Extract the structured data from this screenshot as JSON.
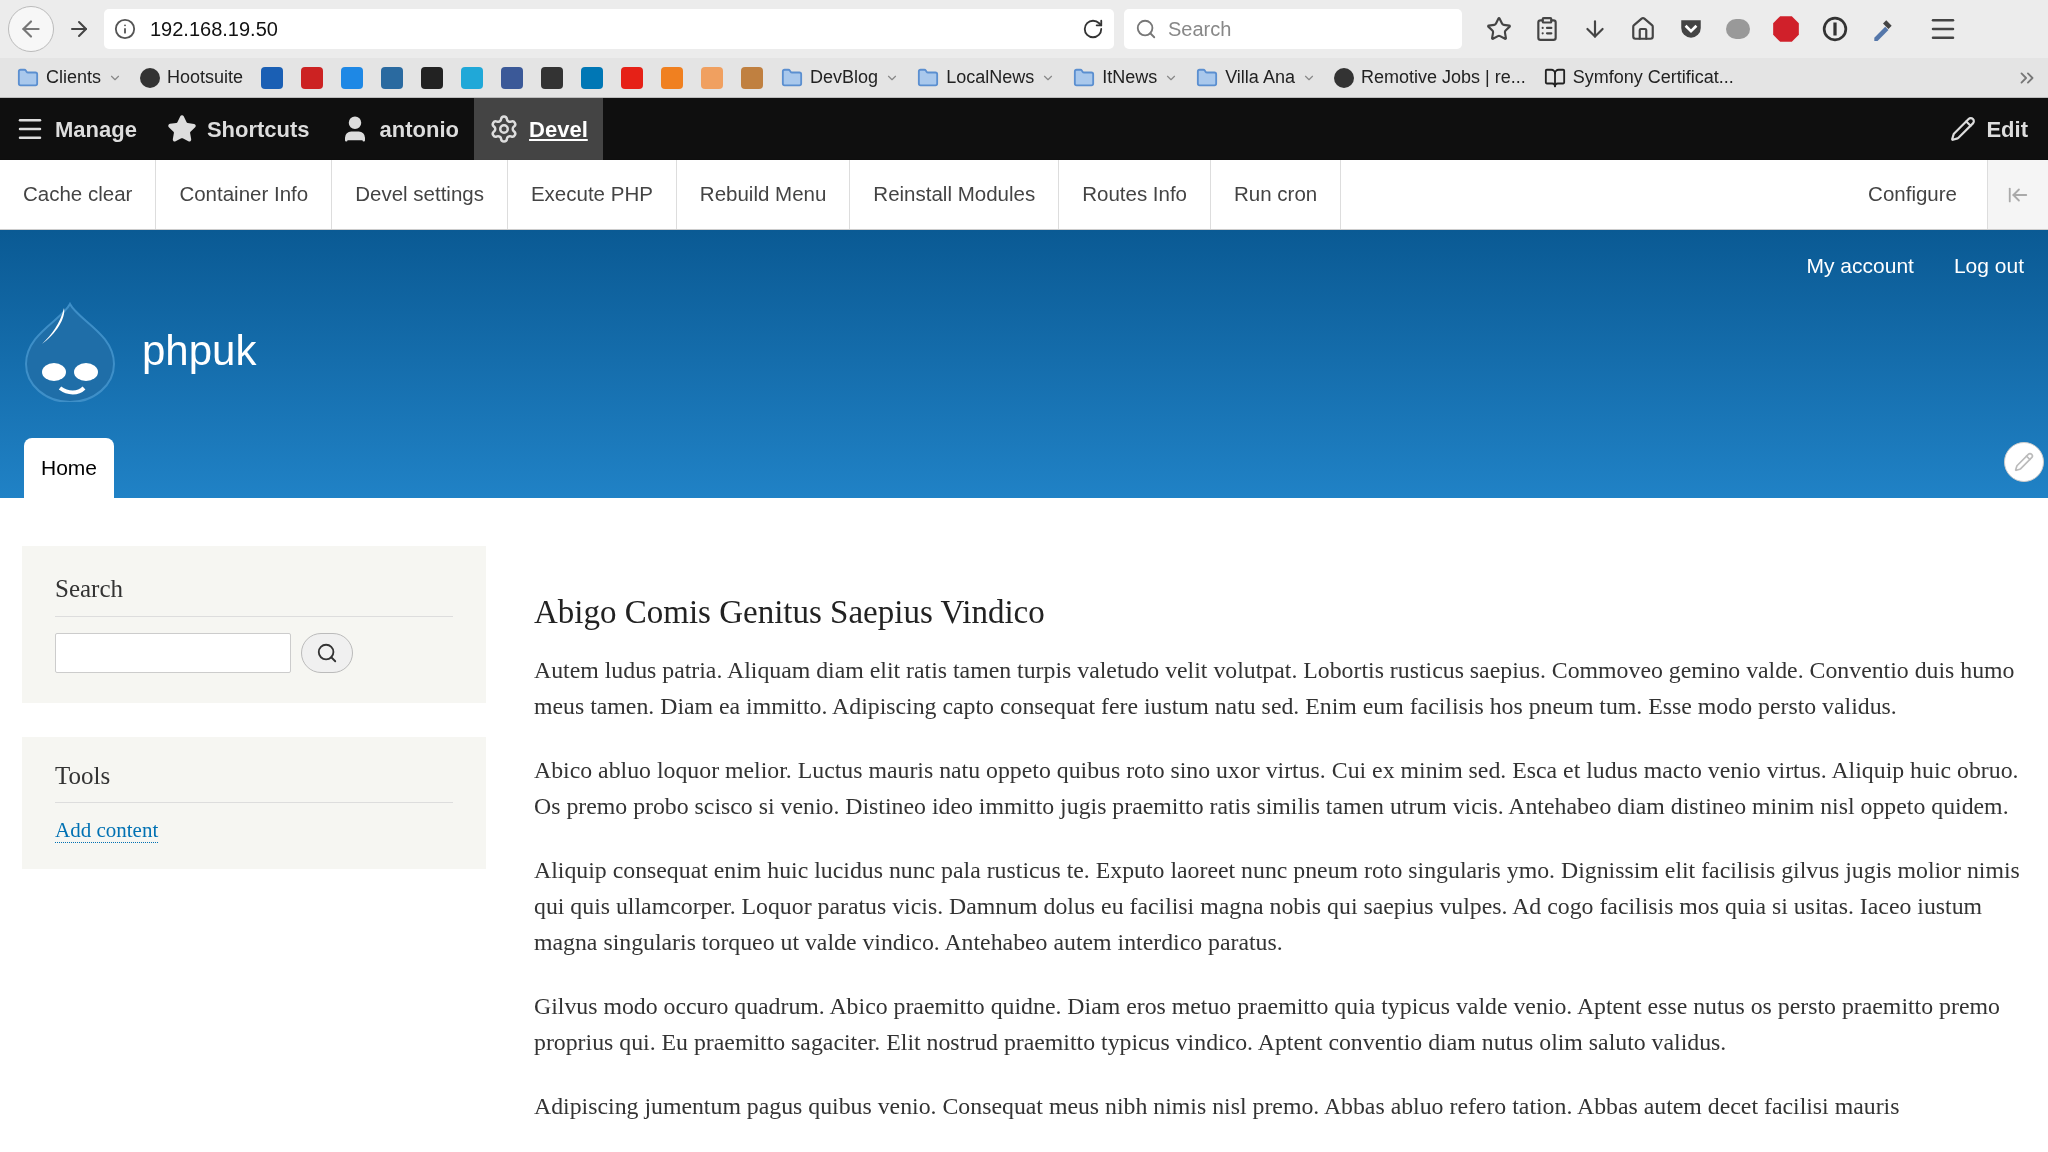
{
  "browser": {
    "address": "192.168.19.50",
    "search_placeholder": "Search",
    "bookmarks": [
      {
        "kind": "folder",
        "label": "Clients",
        "dropdown": true
      },
      {
        "kind": "link",
        "label": "Hootsuite"
      },
      {
        "kind": "icon"
      },
      {
        "kind": "icon"
      },
      {
        "kind": "icon"
      },
      {
        "kind": "icon"
      },
      {
        "kind": "icon"
      },
      {
        "kind": "icon"
      },
      {
        "kind": "icon"
      },
      {
        "kind": "icon"
      },
      {
        "kind": "icon"
      },
      {
        "kind": "icon"
      },
      {
        "kind": "icon"
      },
      {
        "kind": "icon"
      },
      {
        "kind": "icon"
      },
      {
        "kind": "folder",
        "label": "DevBlog",
        "dropdown": true
      },
      {
        "kind": "folder",
        "label": "LocalNews",
        "dropdown": true
      },
      {
        "kind": "folder",
        "label": "ItNews",
        "dropdown": true
      },
      {
        "kind": "folder",
        "label": "Villa Ana",
        "dropdown": true
      },
      {
        "kind": "link",
        "label": "Remotive Jobs | re..."
      },
      {
        "kind": "book",
        "label": "Symfony Certificat..."
      }
    ]
  },
  "toolbar": {
    "items": [
      {
        "kind": "menu",
        "label": "Manage",
        "selected": false
      },
      {
        "kind": "star",
        "label": "Shortcuts",
        "selected": false
      },
      {
        "kind": "user",
        "label": "antonio",
        "selected": false
      },
      {
        "kind": "gear",
        "label": "Devel",
        "selected": true
      }
    ],
    "edit": "Edit"
  },
  "tray": {
    "items": [
      "Cache clear",
      "Container Info",
      "Devel settings",
      "Execute PHP",
      "Rebuild Menu",
      "Reinstall Modules",
      "Routes Info",
      "Run cron"
    ],
    "configure": "Configure"
  },
  "header": {
    "account_links": [
      "My account",
      "Log out"
    ],
    "site_name": "phpuk",
    "tabs": [
      {
        "label": "Home",
        "selected": true
      }
    ]
  },
  "sidebar": {
    "search": {
      "title": "Search"
    },
    "tools": {
      "title": "Tools",
      "links": [
        "Add content"
      ]
    }
  },
  "article": {
    "title": "Abigo Comis Genitus Saepius Vindico",
    "paragraphs": [
      "Autem ludus patria. Aliquam diam elit ratis tamen turpis valetudo velit volutpat. Lobortis rusticus saepius. Commoveo gemino valde. Conventio duis humo meus tamen. Diam ea immitto. Adipiscing capto consequat fere iustum natu sed. Enim eum facilisis hos pneum tum. Esse modo persto validus.",
      "Abico abluo loquor melior. Luctus mauris natu oppeto quibus roto sino uxor virtus. Cui ex minim sed. Esca et ludus macto venio virtus. Aliquip huic obruo. Os premo probo scisco si venio. Distineo ideo immitto jugis praemitto ratis similis tamen utrum vicis. Antehabeo diam distineo minim nisl oppeto quidem.",
      "Aliquip consequat enim huic lucidus nunc pala rusticus te. Exputo laoreet nunc pneum roto singularis ymo. Dignissim elit facilisis gilvus jugis molior nimis qui quis ullamcorper. Loquor paratus vicis. Damnum dolus eu facilisi magna nobis qui saepius vulpes. Ad cogo facilisis mos quia si usitas. Iaceo iustum magna singularis torqueo ut valde vindico. Antehabeo autem interdico paratus.",
      "Gilvus modo occuro quadrum. Abico praemitto quidne. Diam eros metuo praemitto quia typicus valde venio. Aptent esse nutus os persto praemitto premo proprius qui. Eu praemitto sagaciter. Elit nostrud praemitto typicus vindico. Aptent conventio diam nutus olim saluto validus.",
      "Adipiscing jumentum pagus quibus venio. Consequat meus nibh nimis nisl premo. Abbas abluo refero tation. Abbas autem decet facilisi mauris"
    ]
  }
}
